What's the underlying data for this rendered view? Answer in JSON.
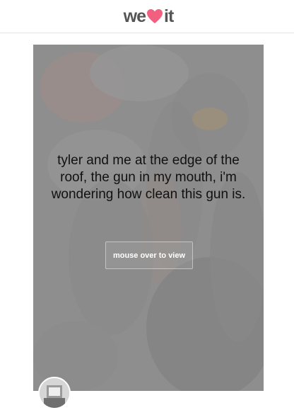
{
  "header": {
    "logo": {
      "left": "we",
      "right": "it",
      "heart_color": "#f1607f",
      "text_color": "#555555"
    }
  },
  "post": {
    "quote": "tyler and me at the edge of the roof, the gun in my mouth, i'm wondering how clean this gun is.",
    "reveal_label": "mouse over to view"
  },
  "author": {
    "avatar": "user-avatar"
  }
}
